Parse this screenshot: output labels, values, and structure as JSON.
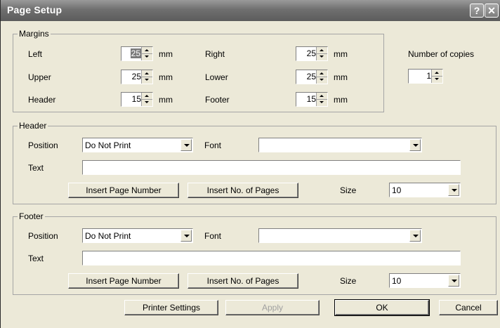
{
  "window": {
    "title": "Page Setup",
    "help_button": "?",
    "close_button": "✕"
  },
  "margins": {
    "legend": "Margins",
    "unit": "mm",
    "left": {
      "label": "Left",
      "value": "25"
    },
    "right": {
      "label": "Right",
      "value": "25"
    },
    "upper": {
      "label": "Upper",
      "value": "25"
    },
    "lower": {
      "label": "Lower",
      "value": "25"
    },
    "header": {
      "label": "Header",
      "value": "15"
    },
    "footer": {
      "label": "Footer",
      "value": "15"
    }
  },
  "copies": {
    "label": "Number of copies",
    "value": "1"
  },
  "header": {
    "legend": "Header",
    "position_label": "Position",
    "position_value": "Do Not Print",
    "font_label": "Font",
    "font_value": "",
    "text_label": "Text",
    "text_value": "",
    "insert_page_number": "Insert Page Number",
    "insert_no_pages": "Insert No. of Pages",
    "size_label": "Size",
    "size_value": "10"
  },
  "footer": {
    "legend": "Footer",
    "position_label": "Position",
    "position_value": "Do Not Print",
    "font_label": "Font",
    "font_value": "",
    "text_label": "Text",
    "text_value": "",
    "insert_page_number": "Insert Page Number",
    "insert_no_pages": "Insert No. of Pages",
    "size_label": "Size",
    "size_value": "10"
  },
  "buttons": {
    "printer_settings": "Printer Settings",
    "apply": "Apply",
    "ok": "OK",
    "cancel": "Cancel"
  }
}
